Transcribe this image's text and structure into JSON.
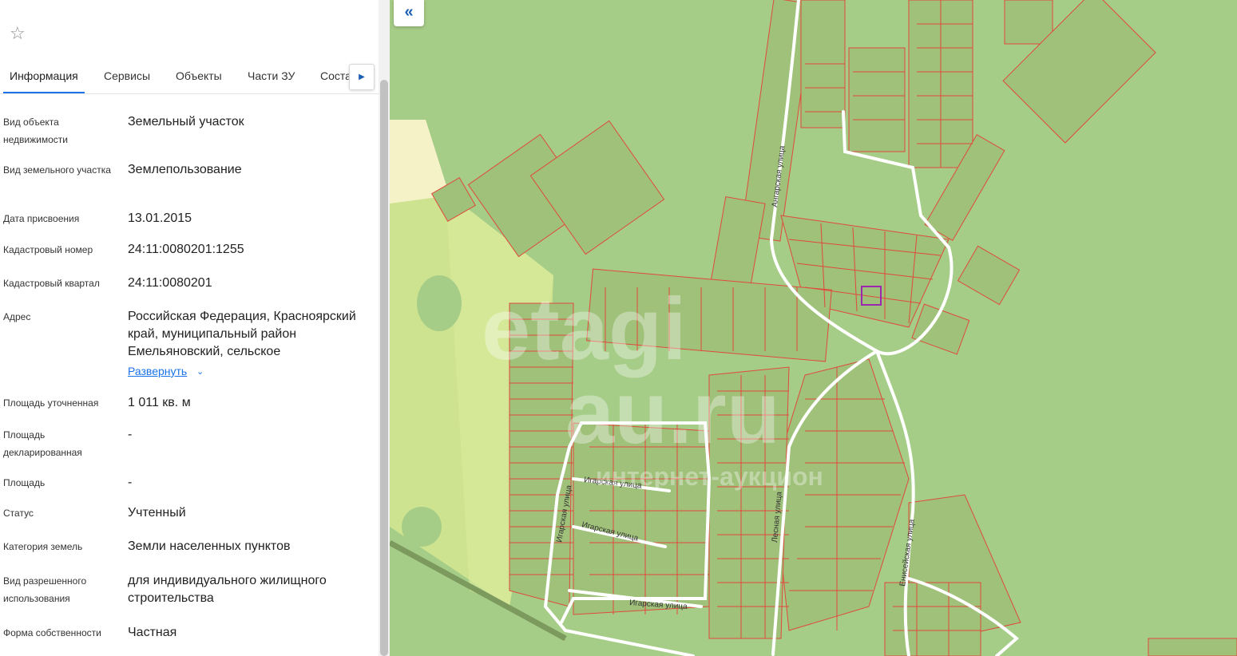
{
  "panel": {
    "tabs": [
      "Информация",
      "Сервисы",
      "Объекты",
      "Части ЗУ",
      "Соста"
    ],
    "active_tab": "Информация",
    "fields": [
      {
        "label": "Вид объекта недвижимости",
        "value": "Земельный участок"
      },
      {
        "label": "Вид земельного участка",
        "value": "Землепользование"
      },
      {
        "label": "Дата присвоения",
        "value": "13.01.2015"
      },
      {
        "label": "Кадастровый номер",
        "value": "24:11:0080201:1255"
      },
      {
        "label": "Кадастровый квартал",
        "value": "24:11:0080201"
      },
      {
        "label": "Адрес",
        "value": "Российская Федерация, Красноярский край, муниципальный район Емельяновский, сельское"
      },
      {
        "label": "Площадь уточненная",
        "value": "1 011 кв. м"
      },
      {
        "label": "Площадь декларированная",
        "value": "-"
      },
      {
        "label": "Площадь",
        "value": "-"
      },
      {
        "label": "Статус",
        "value": "Учтенный"
      },
      {
        "label": "Категория земель",
        "value": "Земли населенных пунктов"
      },
      {
        "label": "Вид разрешенного использования",
        "value": "для индивидуального жилищного строительства"
      },
      {
        "label": "Форма собственности",
        "value": "Частная"
      }
    ],
    "expand_label": "Развернуть"
  },
  "map": {
    "streets": {
      "angarskaya": "Ангарская улица",
      "igarskaya": "Игарская улица",
      "lesnaya": "Лесная улица",
      "eniseyskaya": "Енисейская улица"
    },
    "watermark": {
      "line1": "etagi",
      "line2": "au.ru",
      "line3": "интернет-аукцион"
    },
    "colors": {
      "forest": "#a6cd87",
      "field": "#cde38f",
      "parcel_border": "#e0493c",
      "road": "#ffffff",
      "selected": "#9c27b0"
    }
  },
  "icons": {
    "favorite": "star-outline-icon",
    "tabs_next": "chevron-right-icon",
    "collapse": "double-chevron-left-icon",
    "expand": "chevron-down-icon"
  }
}
